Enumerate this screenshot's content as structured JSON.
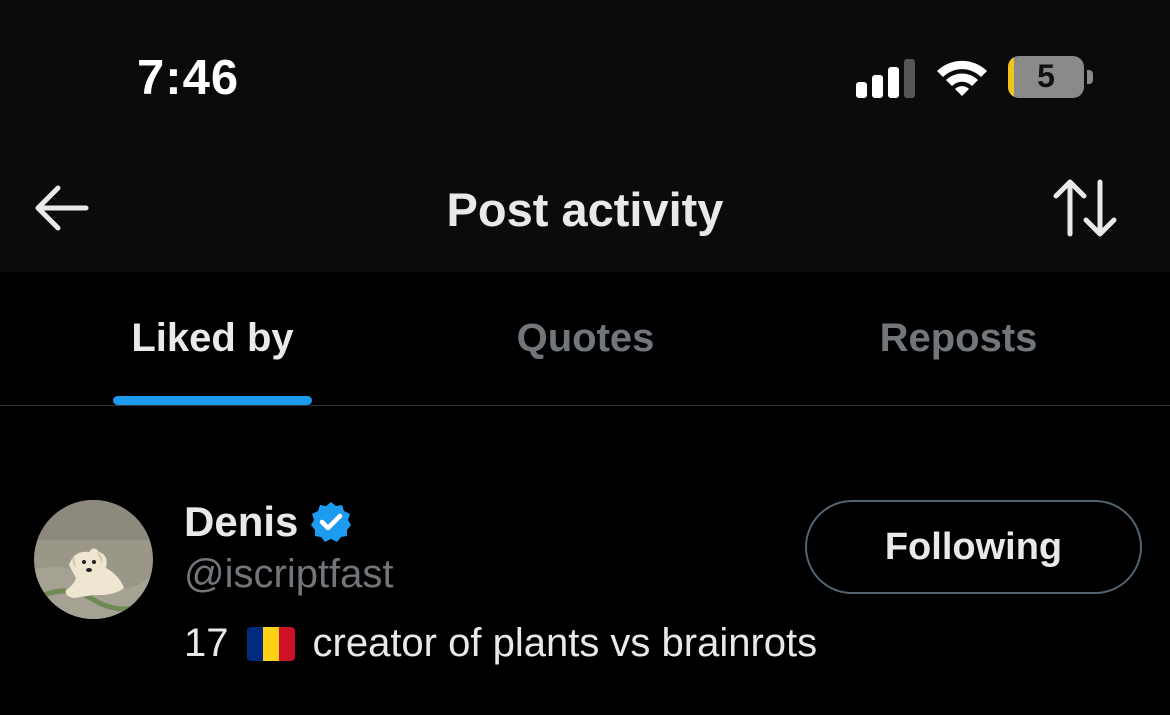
{
  "status_bar": {
    "time": "7:46",
    "signal_icon": "cellular-signal-icon",
    "wifi_icon": "wifi-icon",
    "battery_icon": "battery-icon",
    "battery_level": "5",
    "battery_level_fraction": 0.05,
    "battery_color": "#f0c419"
  },
  "header": {
    "back_icon": "arrow-left-icon",
    "title": "Post activity",
    "sort_icon": "sort-arrows-icon"
  },
  "tabs": [
    {
      "label": "Liked by",
      "active": true
    },
    {
      "label": "Quotes",
      "active": false
    },
    {
      "label": "Reposts",
      "active": false
    }
  ],
  "accent_color": "#1d9bf0",
  "users": [
    {
      "name": "Denis",
      "verified": true,
      "verified_icon": "verified-badge-icon",
      "handle": "@iscriptfast",
      "bio_prefix": "17",
      "bio_flag": "flag-romania-icon",
      "bio_text": "creator of plants vs brainrots",
      "follow_label": "Following"
    }
  ]
}
